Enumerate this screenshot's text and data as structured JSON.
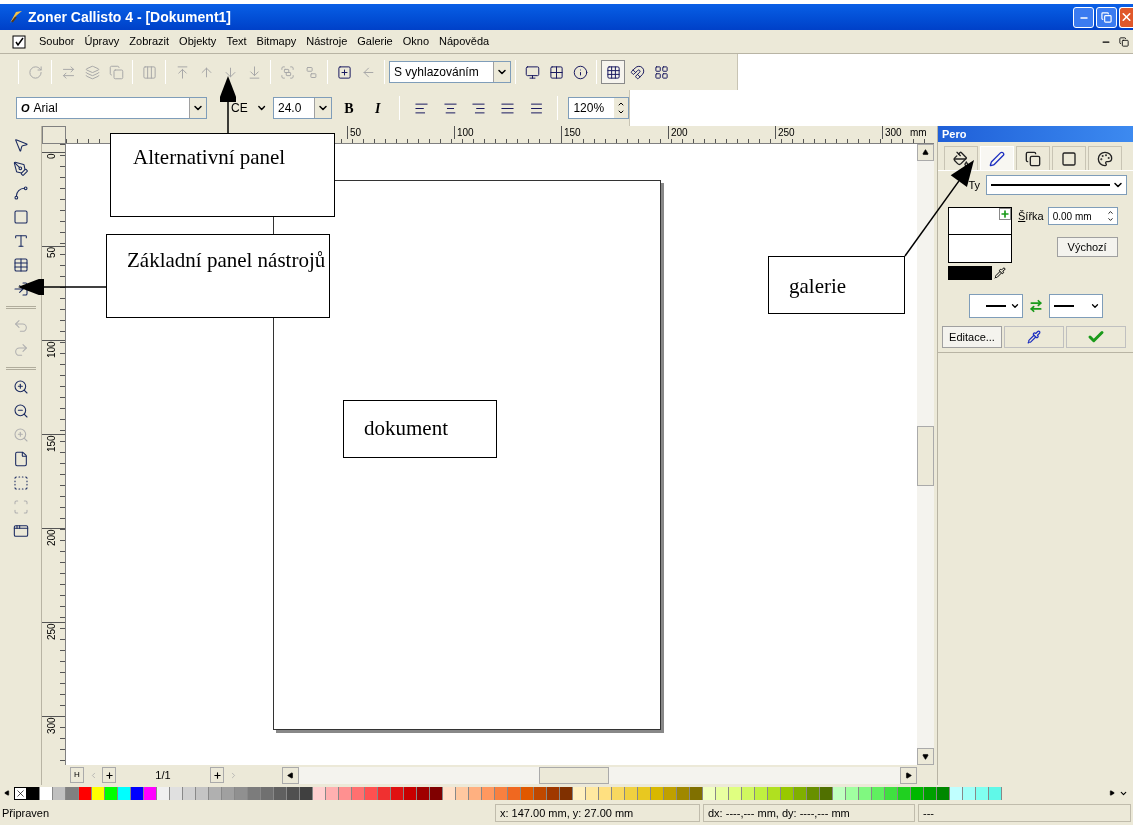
{
  "window": {
    "title": "Zoner Callisto 4 - [Dokument1]"
  },
  "menu": [
    "Soubor",
    "Úpravy",
    "Zobrazit",
    "Objekty",
    "Text",
    "Bitmapy",
    "Nástroje",
    "Galerie",
    "Okno",
    "Nápověda"
  ],
  "toolbar1": {
    "groups_before": [
      [
        {
          "disabled": true
        }
      ],
      [
        {
          "disabled": true
        },
        {
          "disabled": true
        },
        {
          "disabled": true
        }
      ],
      [
        {
          "disabled": true
        }
      ],
      [
        {
          "disabled": true
        },
        {
          "disabled": true
        },
        {
          "disabled": true
        },
        {
          "disabled": true
        }
      ],
      [
        {
          "disabled": true
        },
        {
          "disabled": true
        }
      ],
      [
        {
          "disabled": false
        },
        {
          "disabled": true
        }
      ]
    ],
    "quality": "S vyhlazováním",
    "groups_after": [
      [
        {
          "pressed": false
        },
        {
          "pressed": false
        },
        {
          "pressed": false
        }
      ],
      [
        {
          "pressed": true
        },
        {
          "pressed": false
        },
        {
          "pressed": false
        }
      ]
    ]
  },
  "toolbar2": {
    "font_type_mark": "O",
    "font": "Arial",
    "encoding": "CE",
    "size": "24.0",
    "bold": "B",
    "italic": "I",
    "align": [
      {
        "pressed": false
      },
      {
        "pressed": false
      },
      {
        "pressed": false
      },
      {
        "pressed": false
      },
      {
        "pressed": false
      }
    ],
    "zoom": "120%"
  },
  "toolbox": [
    {
      "disabled": false
    },
    {
      "disabled": false
    },
    {
      "disabled": false
    },
    {
      "disabled": false
    },
    {
      "disabled": false
    },
    {
      "disabled": false
    },
    {
      "disabled": false
    },
    {
      "disabled": true
    },
    {
      "disabled": true
    },
    {
      "disabled": false
    },
    {
      "disabled": false
    },
    {
      "disabled": true
    },
    {
      "disabled": false
    },
    {
      "disabled": false
    },
    {
      "disabled": true
    },
    {
      "disabled": false
    }
  ],
  "ruler": {
    "horizontal": [
      "50",
      "100",
      "150",
      "200",
      "250",
      "300"
    ],
    "unit": "mm",
    "vertical": [
      "0",
      "50",
      "100",
      "150",
      "200",
      "250",
      "300"
    ]
  },
  "page_nav": {
    "first": "H",
    "counter": "1/1"
  },
  "panel": {
    "title": "Pero",
    "tabs": [
      {
        "selected": false
      },
      {
        "selected": true
      },
      {
        "selected": false
      },
      {
        "selected": false
      },
      {
        "selected": false
      }
    ],
    "type_label": "Ty",
    "width_label": "Š",
    "width_label_rest": "ířka",
    "width_value": "0.00 mm",
    "default_button": "Výchozí",
    "edit_button": "Editace..."
  },
  "palette": [
    {
      "color": "#000000"
    },
    {
      "color": "#ffffff"
    },
    {
      "color": "#c0c0c0"
    },
    {
      "color": "#808080"
    },
    {
      "color": "#ff0000"
    },
    {
      "color": "#ffff00"
    },
    {
      "color": "#00ff00"
    },
    {
      "color": "#00ffff"
    },
    {
      "color": "#0000ff"
    },
    {
      "color": "#ff00ff"
    },
    {
      "color": "#f0f0f0"
    },
    {
      "color": "#e0e0e0"
    },
    {
      "color": "#d0d0d0"
    },
    {
      "color": "#c4c4c4"
    },
    {
      "color": "#b0b0b0"
    },
    {
      "color": "#a0a0a0"
    },
    {
      "color": "#909090"
    },
    {
      "color": "#7c7c7c"
    },
    {
      "color": "#707070"
    },
    {
      "color": "#606060"
    },
    {
      "color": "#505050"
    },
    {
      "color": "#404040"
    },
    {
      "color": "#ffd0d0"
    },
    {
      "color": "#ffb0b0"
    },
    {
      "color": "#ff9090"
    },
    {
      "color": "#ff7070"
    },
    {
      "color": "#ff5050"
    },
    {
      "color": "#f03030"
    },
    {
      "color": "#e01010"
    },
    {
      "color": "#c80000"
    },
    {
      "color": "#a00000"
    },
    {
      "color": "#800000"
    },
    {
      "color": "#ffe0c8"
    },
    {
      "color": "#ffc8a0"
    },
    {
      "color": "#ffb080"
    },
    {
      "color": "#ff9860"
    },
    {
      "color": "#f88040"
    },
    {
      "color": "#f06820"
    },
    {
      "color": "#e05800"
    },
    {
      "color": "#c04800"
    },
    {
      "color": "#a03800"
    },
    {
      "color": "#803000"
    },
    {
      "color": "#fff0c0"
    },
    {
      "color": "#ffe8a0"
    },
    {
      "color": "#ffe080"
    },
    {
      "color": "#f8d860"
    },
    {
      "color": "#f0d040"
    },
    {
      "color": "#e8c820"
    },
    {
      "color": "#d8b800"
    },
    {
      "color": "#c0a000"
    },
    {
      "color": "#a08800"
    },
    {
      "color": "#807000"
    },
    {
      "color": "#f0ffc0"
    },
    {
      "color": "#e8ffa0"
    },
    {
      "color": "#e0ff80"
    },
    {
      "color": "#d0f860"
    },
    {
      "color": "#c0f040"
    },
    {
      "color": "#b0e020"
    },
    {
      "color": "#98c800"
    },
    {
      "color": "#80b000"
    },
    {
      "color": "#689000"
    },
    {
      "color": "#507000"
    },
    {
      "color": "#c0ffc0"
    },
    {
      "color": "#a0ffa0"
    },
    {
      "color": "#80f880"
    },
    {
      "color": "#60f060"
    },
    {
      "color": "#40e040"
    },
    {
      "color": "#20d020"
    },
    {
      "color": "#00b800"
    },
    {
      "color": "#00a000"
    },
    {
      "color": "#008800"
    },
    {
      "color": "#c0ffff"
    },
    {
      "color": "#a0fff8"
    },
    {
      "color": "#80fff0"
    },
    {
      "color": "#60f8e8"
    }
  ],
  "status_bar": [
    "Připraven",
    "x: 147.00 mm, y: 27.00 mm",
    "dx: ----,--- mm, dy: ----,--- mm",
    "---"
  ],
  "annotations": [
    {
      "text": "Alternativní panel"
    },
    {
      "text": "Základní panel nástrojů"
    },
    {
      "text": "dokument"
    },
    {
      "text": "galerie"
    }
  ]
}
